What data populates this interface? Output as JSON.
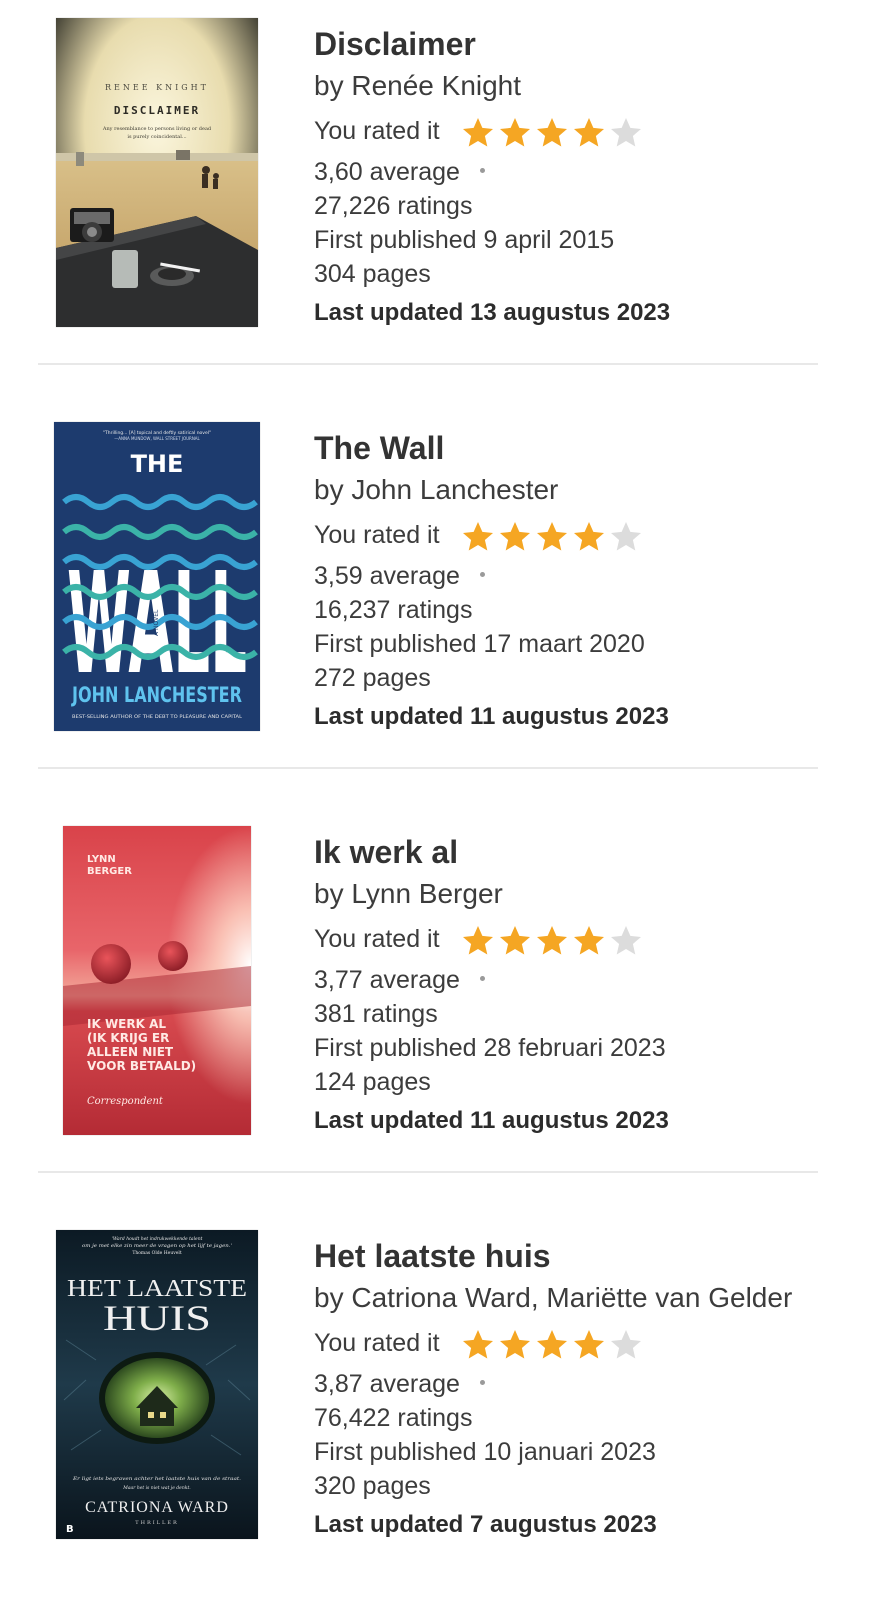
{
  "books": [
    {
      "title": "Disclaimer",
      "author": "by Renée Knight",
      "rated_label": "You rated it",
      "rating": 4,
      "max_rating": 5,
      "average": "3,60 average",
      "ratings_count": "27,226 ratings",
      "first_published": "First published 9 april 2015",
      "pages": "304 pages",
      "last_updated": "Last updated 13 augustus 2023",
      "cover": {
        "author_text": "RENEE KNIGHT",
        "title_text": "DISCLAIMER",
        "tagline_1": "Any resemblance to persons living or dead",
        "tagline_2": "is purely coincidental..."
      }
    },
    {
      "title": "The Wall",
      "author": "by John Lanchester",
      "rated_label": "You rated it",
      "rating": 4,
      "max_rating": 5,
      "average": "3,59 average",
      "ratings_count": "16,237 ratings",
      "first_published": "First published 17 maart 2020",
      "pages": "272 pages",
      "last_updated": "Last updated 11 augustus 2023",
      "cover": {
        "quote_text": "\"Thrilling... [A] topical and deftly satirical novel\"",
        "quote_source": "—ANNA MUNDOW, WALL STREET JOURNAL",
        "title_small": "THE",
        "title_big": "WALL",
        "novel_text": "A NOVEL",
        "author_text": "JOHN LANCHESTER",
        "byline": "BEST-SELLING AUTHOR OF THE DEBT TO PLEASURE AND CAPITAL"
      }
    },
    {
      "title": "Ik werk al",
      "author": "by Lynn Berger",
      "rated_label": "You rated it",
      "rating": 4,
      "max_rating": 5,
      "average": "3,77 average",
      "ratings_count": "381 ratings",
      "first_published": "First published 28 februari 2023",
      "pages": "124 pages",
      "last_updated": "Last updated 11 augustus 2023",
      "cover": {
        "author_line_1": "LYNN",
        "author_line_2": "BERGER",
        "title_line_1": "IK WERK AL",
        "title_line_2": "(IK KRIJG ER",
        "title_line_3": "ALLEEN NIET",
        "title_line_4": "VOOR BETAALD)",
        "publisher": "Correspondent"
      }
    },
    {
      "title": "Het laatste huis",
      "author": "by Catriona Ward, Mariëtte van Gelder",
      "rated_label": "You rated it",
      "rating": 4,
      "max_rating": 5,
      "average": "3,87 average",
      "ratings_count": "76,422 ratings",
      "first_published": "First published 10 januari 2023",
      "pages": "320 pages",
      "last_updated": "Last updated 7 augustus 2023",
      "cover": {
        "quote_1": "'Ward houdt het indrukwekkende talent",
        "quote_2": "om je met elke zin meer de vragen op het lijf te jagen.'",
        "quote_source": "Thomas Olde Heuvelt",
        "title_line_1": "HET LAATSTE",
        "title_line_2": "HUIS",
        "blurb_1": "Er ligt iets begraven achter het laatste huis van de straat.",
        "blurb_2": "Maar het is niet wat je denkt.",
        "author_text": "CATRIONA WARD",
        "genre": "THRILLER",
        "publisher_mark": "B"
      }
    }
  ],
  "colors": {
    "star_filled": "#f5a623",
    "star_empty": "#dcdcdc",
    "divider": "#e8e8e8",
    "wall_blue": "#1d3b6e",
    "ikwerk_red": "#c8343c"
  }
}
